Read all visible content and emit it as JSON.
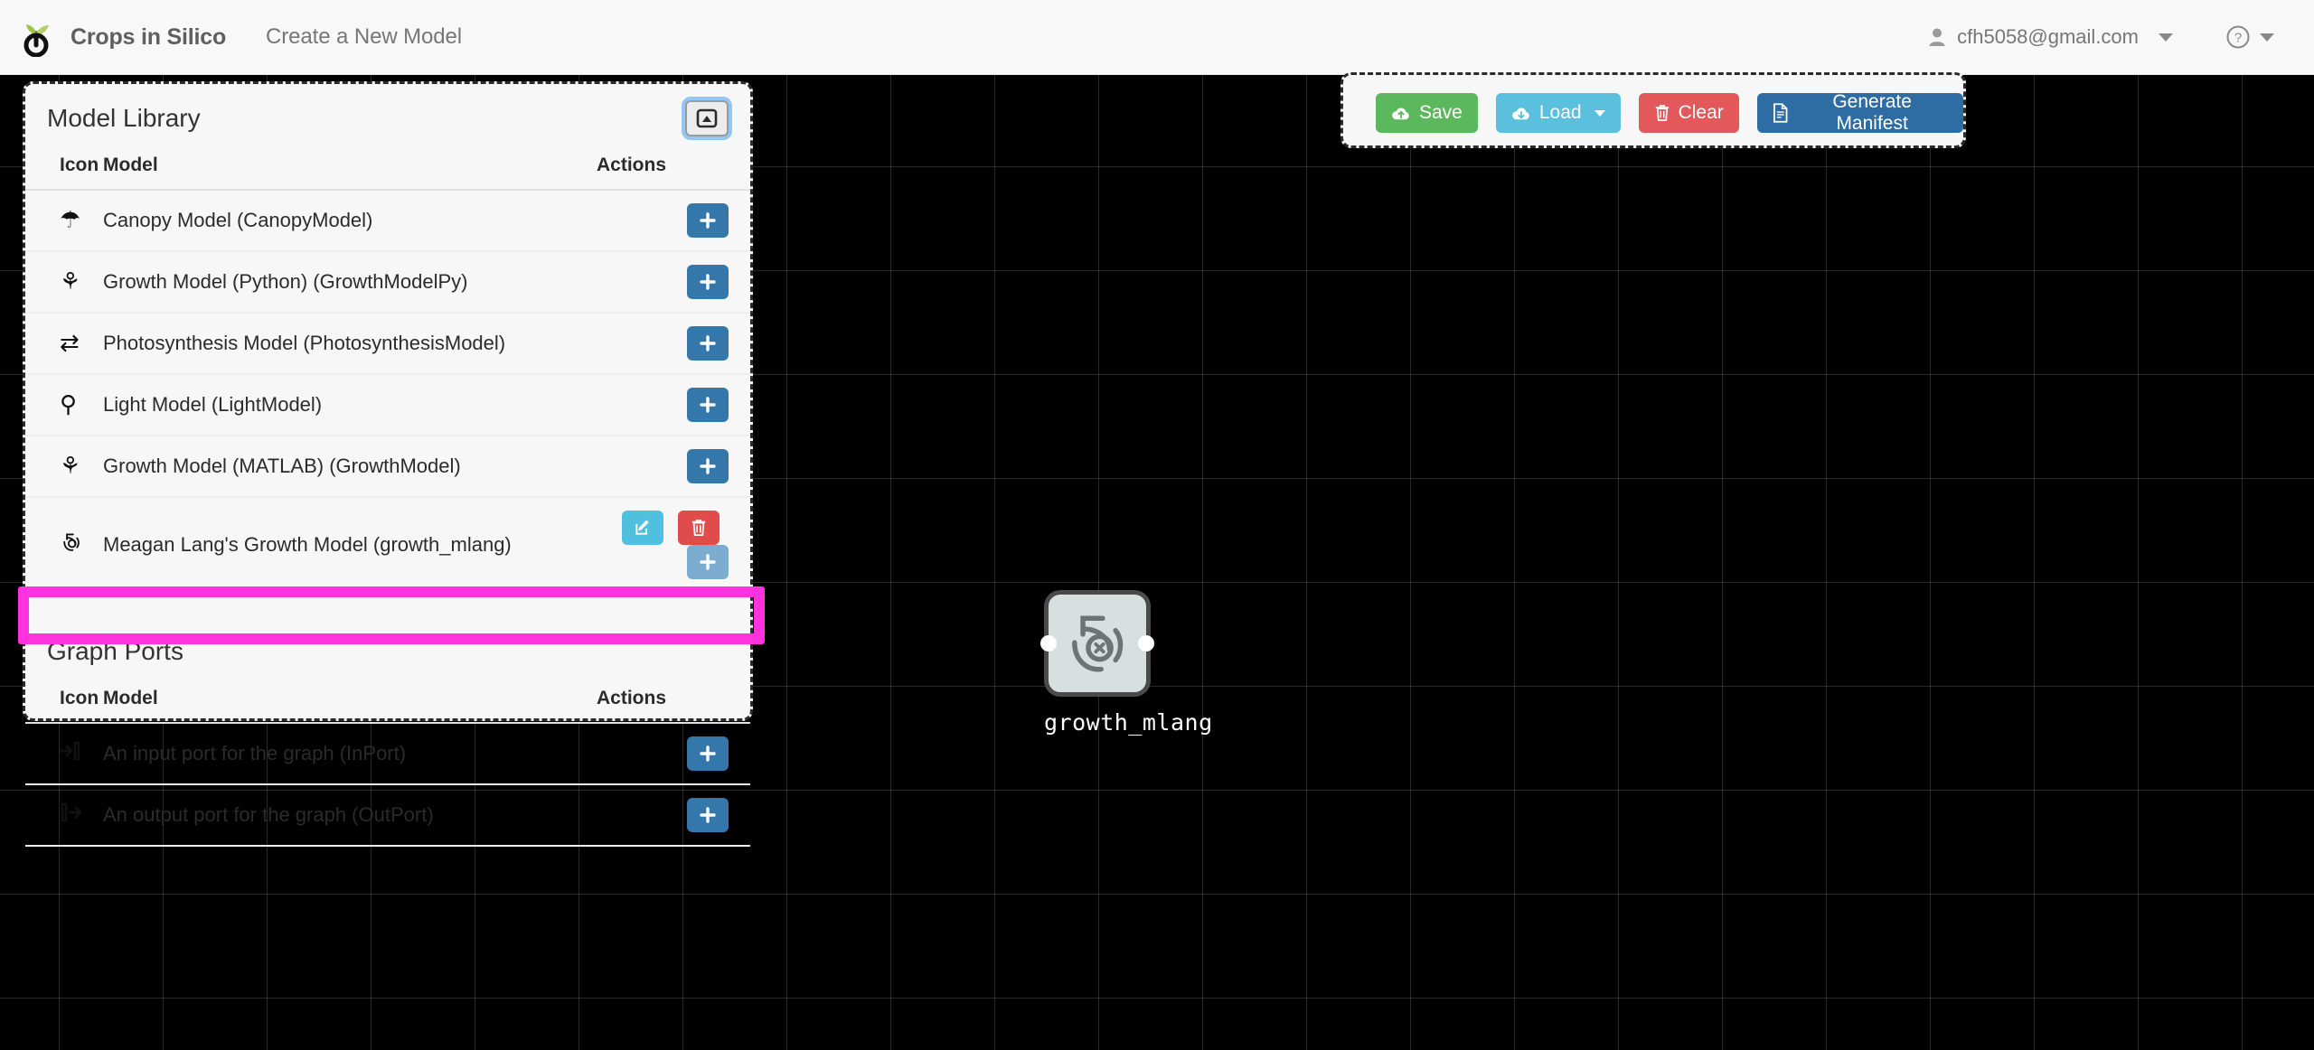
{
  "header": {
    "logo_icon": "sprout-power-logo",
    "brand": "Crops in Silico",
    "nav_link": "Create a New Model",
    "user_icon": "user-icon",
    "user_email": "cfh5058@gmail.com",
    "user_caret_icon": "caret-down-icon",
    "help_icon": "question-circle-icon",
    "help_caret_icon": "caret-down-icon"
  },
  "model_library": {
    "title": "Model Library",
    "collapse_icon": "collapse-panel-icon",
    "columns": [
      "Icon",
      "Model",
      "Actions"
    ],
    "rows": [
      {
        "icon": "umbrella-icon",
        "glyph": "☂",
        "label": "Canopy Model (CanopyModel)",
        "actions": [
          "add"
        ]
      },
      {
        "icon": "seedling-icon",
        "glyph": "⚘",
        "label": "Growth Model (Python) (GrowthModelPy)",
        "actions": [
          "add"
        ]
      },
      {
        "icon": "exchange-icon",
        "glyph": "⇄",
        "label": "Photosynthesis Model (PhotosynthesisModel)",
        "actions": [
          "add"
        ]
      },
      {
        "icon": "lightbulb-icon",
        "glyph": "⚲",
        "label": "Light Model (LightModel)",
        "actions": [
          "add"
        ]
      },
      {
        "icon": "seedling-icon",
        "glyph": "⚘",
        "label": "Growth Model (MATLAB) (GrowthModel)",
        "actions": [
          "add"
        ]
      },
      {
        "icon": "cis-spiral-icon",
        "glyph": "",
        "label": "Meagan Lang's Growth Model (growth_mlang)",
        "actions": [
          "edit",
          "delete",
          "add-muted"
        ]
      }
    ]
  },
  "graph_ports": {
    "title": "Graph Ports",
    "columns": [
      "Icon",
      "Model",
      "Actions"
    ],
    "rows": [
      {
        "icon": "sign-in-icon",
        "glyph": "⇥",
        "label": "An input port for the graph (InPort)",
        "actions": [
          "add"
        ],
        "highlighted": true
      },
      {
        "icon": "sign-out-icon",
        "glyph": "↦",
        "label": "An output port for the graph (OutPort)",
        "actions": [
          "add"
        ],
        "highlighted": false
      }
    ]
  },
  "toolbar": {
    "save_label": "Save",
    "save_icon": "cloud-upload-icon",
    "load_label": "Load",
    "load_icon": "cloud-download-icon",
    "load_caret_icon": "caret-down-icon",
    "clear_label": "Clear",
    "clear_icon": "trash-icon",
    "manifest_label": "Generate Manifest",
    "manifest_icon": "file-text-icon"
  },
  "canvas": {
    "node": {
      "label": "growth_mlang",
      "icon": "cis-spiral-icon",
      "in_port": "input-port",
      "out_port": "output-port"
    }
  },
  "annotation": {
    "target": "An input port for the graph (InPort)",
    "color": "#ff33dd"
  },
  "colors": {
    "canvas_bg": "#000000",
    "panel_bg": "#f7f7f7",
    "header_bg": "#f8f8f8",
    "add_button": "#3478ab",
    "edit_button": "#4fc0de",
    "delete_button": "#e04b4b",
    "save_button": "#5cb85c",
    "load_button": "#5bc0de",
    "clear_button": "#e2585b",
    "manifest_button": "#2e6da4",
    "highlight": "#ff33dd"
  }
}
